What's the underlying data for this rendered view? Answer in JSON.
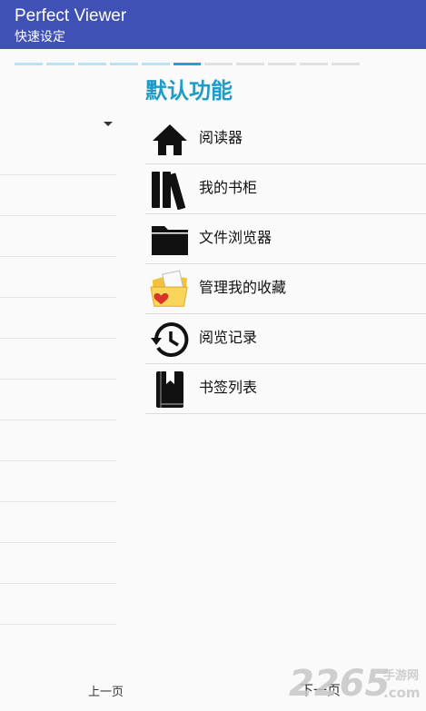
{
  "appbar": {
    "title": "Perfect Viewer",
    "subtitle": "快速设定"
  },
  "progress": {
    "total_steps": 11,
    "current_step": 6
  },
  "section": {
    "title": "默认功能"
  },
  "functions": [
    {
      "label": "阅读器",
      "icon": "home-icon"
    },
    {
      "label": "我的书柜",
      "icon": "bookshelf-icon"
    },
    {
      "label": "文件浏览器",
      "icon": "folder-icon"
    },
    {
      "label": "管理我的收藏",
      "icon": "favorites-folder-icon"
    },
    {
      "label": "阅览记录",
      "icon": "history-icon"
    },
    {
      "label": "书签列表",
      "icon": "bookmark-book-icon"
    }
  ],
  "footer": {
    "prev_label": "上一页",
    "next_label": "下一页"
  },
  "watermark": {
    "text": "2265",
    "domain": ".com",
    "site": "手游网"
  },
  "colors": {
    "appbar": "#3f51b5",
    "accent": "#1e9bc8",
    "step_done": "#b9e3f2",
    "step_todo": "#e0e0e0"
  }
}
